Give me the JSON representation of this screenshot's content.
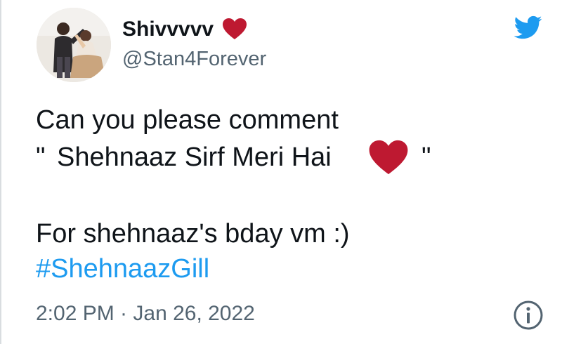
{
  "user": {
    "display_name": "Shivvvvv",
    "handle": "@Stan4Forever",
    "name_emoji": "heart-icon"
  },
  "tweet": {
    "line1": "Can you please comment",
    "line2_open_quote": "\"",
    "line2_text": "Shehnaaz Sirf Meri Hai",
    "line2_emoji": "heart-icon",
    "line2_close_quote": "\"",
    "line3": "For shehnaaz's bday vm :)",
    "hashtag": "#ShehnaazGill"
  },
  "meta": {
    "timestamp": "2:02 PM · Jan 26, 2022"
  },
  "icons": {
    "brand": "twitter-bird-icon",
    "info": "info-icon"
  },
  "colors": {
    "brand_blue": "#1d9bf0",
    "heart_red": "#be1931",
    "secondary_text": "#536471",
    "primary_text": "#0f1419"
  }
}
